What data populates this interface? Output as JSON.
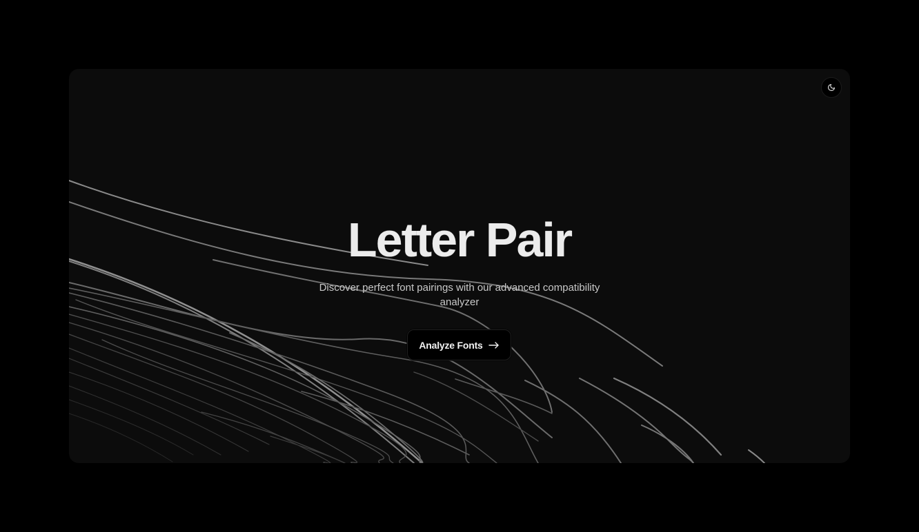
{
  "hero": {
    "title": "Letter Pair",
    "subtitle": "Discover perfect font pairings with our advanced compatibility analyzer",
    "cta_label": "Analyze Fonts"
  },
  "icons": {
    "theme_toggle": "moon-icon",
    "cta_arrow": "arrow-right-icon"
  },
  "colors": {
    "page_background": "#000000",
    "card_background": "#0c0c0c",
    "title": "#ececec",
    "subtitle": "#c9c9c9",
    "line_stroke": "#ffffff"
  }
}
